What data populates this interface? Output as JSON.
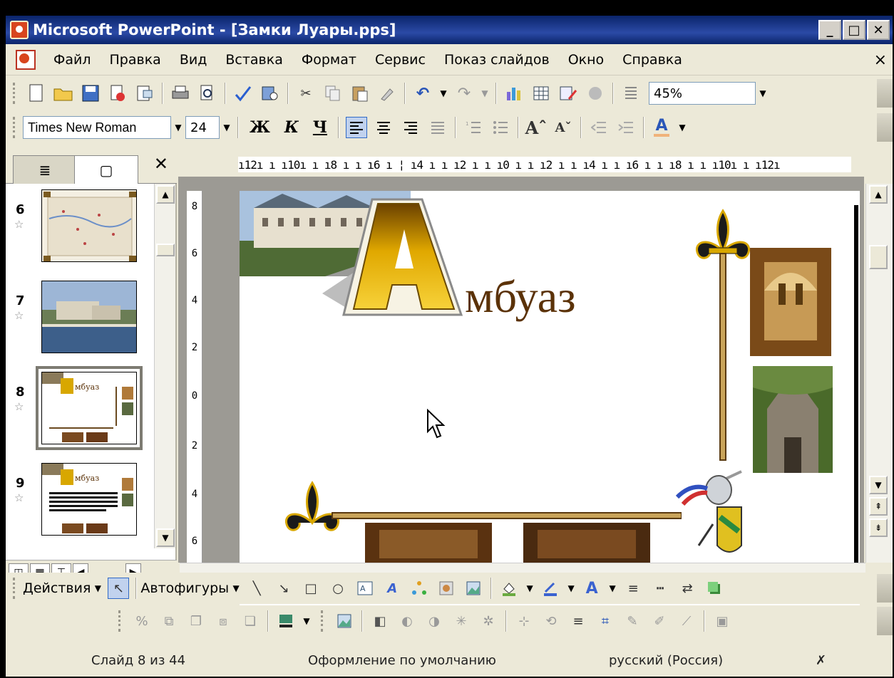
{
  "window": {
    "title": "Microsoft PowerPoint - [Замки Луары.pps]",
    "btn_min": "_",
    "btn_max": "□",
    "btn_close": "✕"
  },
  "menu": {
    "items": [
      "Файл",
      "Правка",
      "Вид",
      "Вставка",
      "Формат",
      "Сервис",
      "Показ слайдов",
      "Окно",
      "Справка"
    ],
    "close": "×"
  },
  "toolbar_standard": {
    "zoom_value": "45%"
  },
  "toolbar_formatting": {
    "font_name": "Times New Roman",
    "font_size": "24",
    "bold": "Ж",
    "italic": "К",
    "underline": "Ч",
    "font_color_label": "A"
  },
  "left_pane": {
    "tab_outline_icon": "≣",
    "tab_slides_icon": "▢",
    "close": "✕",
    "slides": [
      {
        "number": "6"
      },
      {
        "number": "7"
      },
      {
        "number": "8"
      },
      {
        "number": "9"
      }
    ],
    "star": "☆"
  },
  "ruler": {
    "horizontal": "ı12ı ı ı10ı ı ı8 ı ı ı6 ı ¦ ı4 ı ı ı2 ı ı ı0 ı ı ı2 ı ı ı4 ı ı ı6 ı ı ı8 ı ı ı10ı ı ı12ı",
    "vertical_ticks": [
      "8",
      "6",
      "4",
      "2",
      "0",
      "2",
      "4",
      "6"
    ]
  },
  "slide": {
    "title_letter": "А",
    "title_rest": "мбуаз"
  },
  "drawing_toolbar": {
    "actions": "Действия",
    "autoshapes": "Автофигуры"
  },
  "status": {
    "slide_counter": "Слайд 8 из 44",
    "design": "Оформление по умолчанию",
    "language": "русский (Россия)"
  },
  "colors": {
    "title_bar": "#0a246a",
    "chrome": "#ece9d8",
    "slide_text": "#5b3208",
    "gold": "#e0a800"
  }
}
